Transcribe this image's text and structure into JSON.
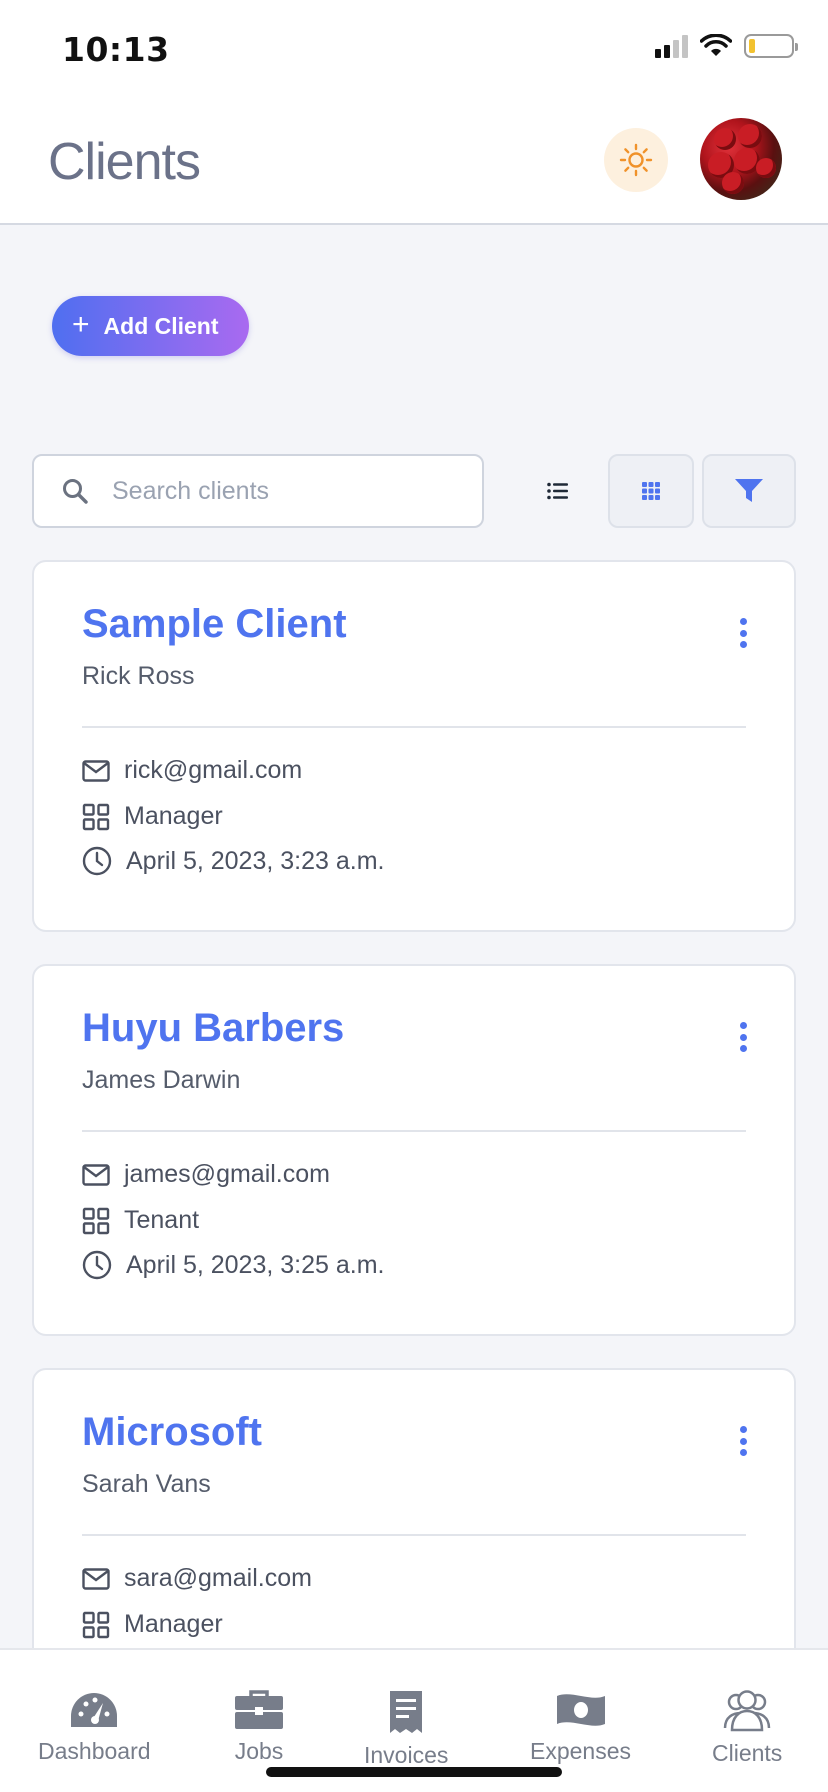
{
  "status_bar": {
    "time": "10:13"
  },
  "header": {
    "title": "Clients"
  },
  "actions": {
    "add_client_label": "Add Client"
  },
  "search": {
    "placeholder": "Search clients"
  },
  "clients": [
    {
      "name": "Sample Client",
      "contact": "Rick Ross",
      "email": "rick@gmail.com",
      "role": "Manager",
      "date": "April 5, 2023, 3:23 a.m."
    },
    {
      "name": "Huyu Barbers",
      "contact": "James Darwin",
      "email": "james@gmail.com",
      "role": "Tenant",
      "date": "April 5, 2023, 3:25 a.m."
    },
    {
      "name": "Microsoft",
      "contact": "Sarah Vans",
      "email": "sara@gmail.com",
      "role": "Manager",
      "date": ""
    }
  ],
  "bottom_nav": {
    "items": [
      {
        "label": "Dashboard",
        "icon": "dashboard-gauge-icon"
      },
      {
        "label": "Jobs",
        "icon": "briefcase-icon"
      },
      {
        "label": "Invoices",
        "icon": "receipt-icon"
      },
      {
        "label": "Expenses",
        "icon": "money-bill-icon"
      },
      {
        "label": "Clients",
        "icon": "users-icon"
      }
    ]
  },
  "colors": {
    "accent": "#4f74ef",
    "gradient_start": "#4f6ff0",
    "gradient_end": "#a96af0",
    "background": "#f4f5f9",
    "sun": "#f0922a"
  }
}
